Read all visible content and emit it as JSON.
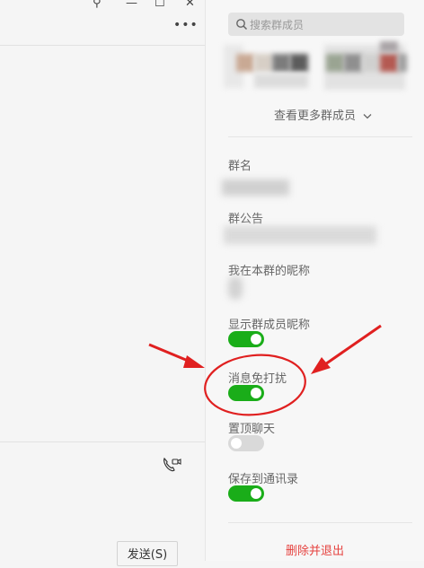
{
  "window": {
    "pin_icon": "pin-icon",
    "minimize_icon": "minimize-icon",
    "maximize_icon": "maximize-icon",
    "close_icon": "close-icon",
    "more_icon": "more-dots-icon"
  },
  "chat": {
    "send_label": "发送(S)",
    "video_call_icon": "video-call-icon"
  },
  "panel": {
    "search_placeholder": "搜索群成员",
    "view_more_label": "查看更多群成员",
    "group_name_label": "群名",
    "announcement_label": "群公告",
    "my_nickname_label": "我在本群的昵称",
    "show_nicknames_label": "显示群成员昵称",
    "do_not_disturb_label": "消息免打扰",
    "pin_chat_label": "置顶聊天",
    "save_contacts_label": "保存到通讯录",
    "delete_exit_label": "删除并退出"
  },
  "toggles": {
    "show_nicknames": true,
    "do_not_disturb": true,
    "pin_chat": false,
    "save_contacts": true
  },
  "colors": {
    "accent_green": "#1aad19",
    "danger_red": "#e64340",
    "annotation_red": "#e02020"
  }
}
